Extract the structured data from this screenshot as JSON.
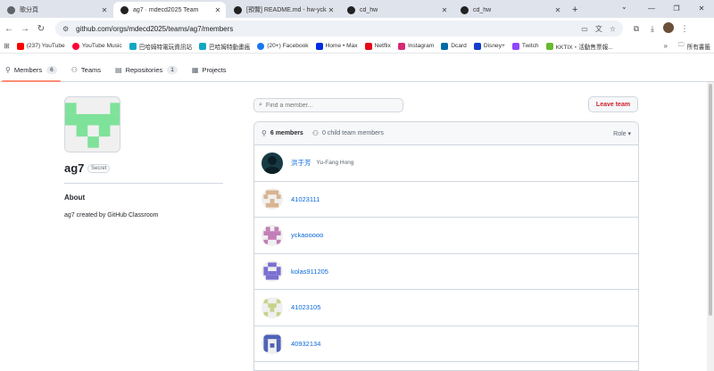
{
  "browser": {
    "tabs": [
      {
        "title": "歌分頁",
        "active": false,
        "icon": "chrome-icon"
      },
      {
        "title": "ag7 · mdecd2025 Team",
        "active": true,
        "icon": "github-icon"
      },
      {
        "title": "[預覽] README.md - hw-ycka",
        "active": false,
        "icon": "github-icon"
      },
      {
        "title": "cd_hw",
        "active": false,
        "icon": "github-icon"
      },
      {
        "title": "cd_hw",
        "active": false,
        "icon": "github-icon"
      }
    ],
    "new_tab": "+",
    "url": "github.com/orgs/mdecd2025/teams/ag7/members",
    "bookmarks": [
      {
        "label": "(237) YouTube",
        "color": "#ff0000"
      },
      {
        "label": "YouTube Music",
        "color": "#ff0033"
      },
      {
        "label": "巴哈姆特電玩資訊站",
        "color": "#13a6c4"
      },
      {
        "label": "巴哈姆特動畫瘋",
        "color": "#13a6c4"
      },
      {
        "label": "(20+) Facebook",
        "color": "#1877f2"
      },
      {
        "label": "Home • Max",
        "color": "#002be7"
      },
      {
        "label": "Netflix",
        "color": "#e50914"
      },
      {
        "label": "Instagram",
        "color": "#d62976"
      },
      {
        "label": "Dcard",
        "color": "#006aa6"
      },
      {
        "label": "Disney+",
        "color": "#113ccf"
      },
      {
        "label": "Twitch",
        "color": "#9146ff"
      },
      {
        "label": "KKTIX・活動售票報...",
        "color": "#68b92e"
      }
    ],
    "all_bookmarks": "所有書籤"
  },
  "teamnav": {
    "members": {
      "label": "Members",
      "count": "6"
    },
    "teams": {
      "label": "Teams"
    },
    "repositories": {
      "label": "Repositories",
      "count": "1"
    },
    "projects": {
      "label": "Projects"
    }
  },
  "team": {
    "name": "ag7",
    "visibility": "Secret",
    "about_heading": "About",
    "about_text": "ag7 created by GitHub Classroom"
  },
  "members_panel": {
    "search_placeholder": "Find a member...",
    "leave_label": "Leave team",
    "members_count": "6 members",
    "child_members": "0 child team members",
    "role_label": "Role ▾",
    "members": [
      {
        "login": "洪于芳",
        "fullname": "Yu-Fang Hong",
        "avatar_color": "#173b45"
      },
      {
        "login": "41023111",
        "fullname": "",
        "avatar_color": "#d9b48f"
      },
      {
        "login": "yckaooooo",
        "fullname": "",
        "avatar_color": "#c27fb8"
      },
      {
        "login": "kolas911205",
        "fullname": "",
        "avatar_color": "#7b6fd0"
      },
      {
        "login": "41023105",
        "fullname": "",
        "avatar_color": "#c6d48a"
      },
      {
        "login": "40932134",
        "fullname": "",
        "avatar_color": "#5162b8"
      }
    ]
  }
}
